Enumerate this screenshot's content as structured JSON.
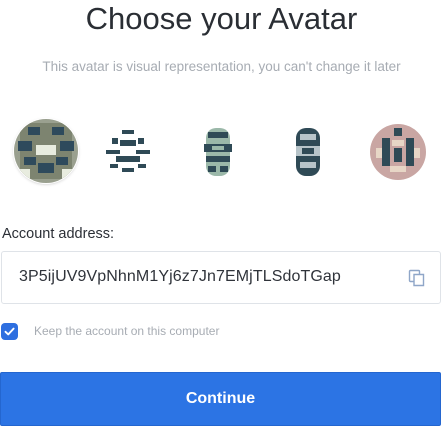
{
  "header": {
    "title": "Choose your Avatar",
    "subtitle": "This avatar is visual representation, you can't change it later"
  },
  "avatars": [
    {
      "icon": "identicon-avatar-1",
      "selected": true
    },
    {
      "icon": "identicon-avatar-2",
      "selected": false
    },
    {
      "icon": "identicon-avatar-3",
      "selected": false
    },
    {
      "icon": "identicon-avatar-4",
      "selected": false
    },
    {
      "icon": "identicon-avatar-5",
      "selected": false
    }
  ],
  "account": {
    "label": "Account address:",
    "address": "3P5ijUV9VpNhnM1Yj6z7Jn7EMjTLSdoTGap",
    "copy_icon": "copy-icon"
  },
  "keep": {
    "checked": true,
    "label": "Keep the account on this computer"
  },
  "actions": {
    "continue_label": "Continue"
  },
  "colors": {
    "accent": "#2c74e4",
    "muted_text": "#a7acb3"
  }
}
